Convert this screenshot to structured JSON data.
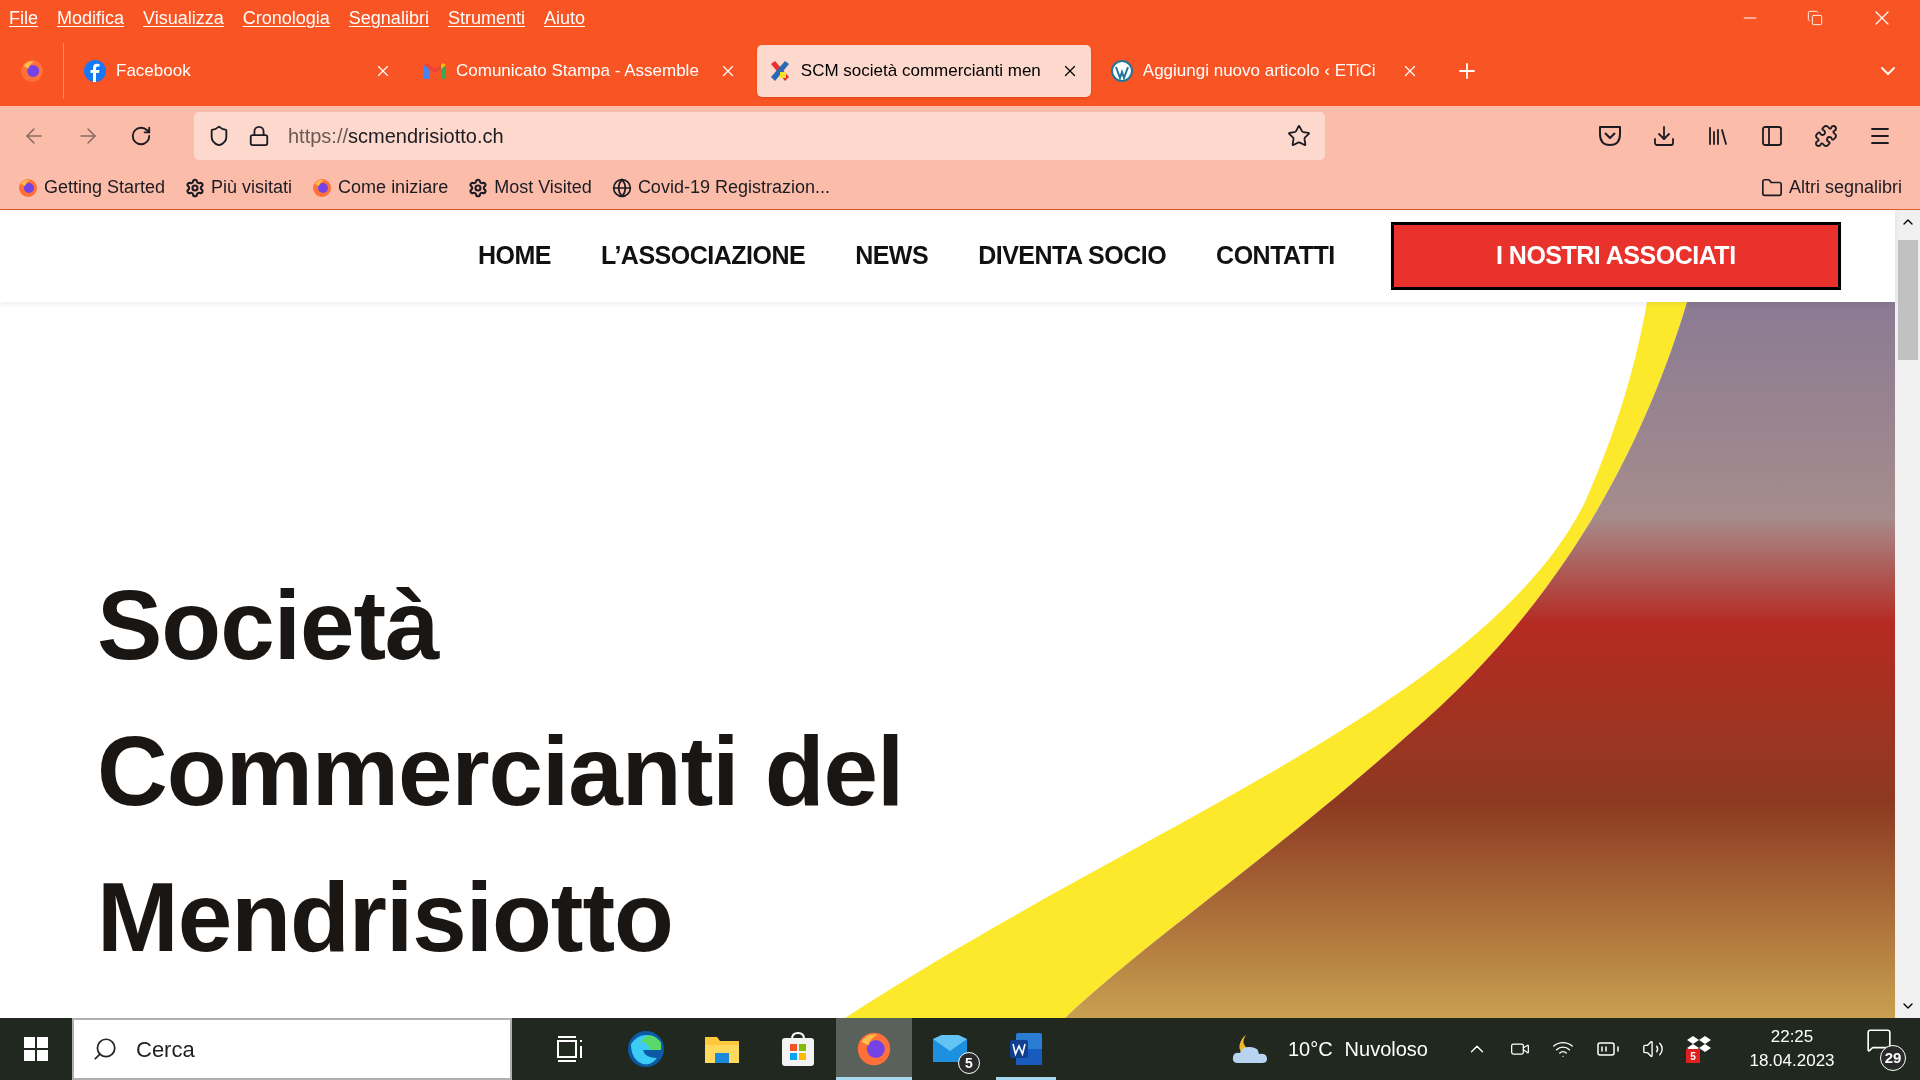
{
  "menu_bar": [
    "File",
    "Modifica",
    "Visualizza",
    "Cronologia",
    "Segnalibri",
    "Strumenti",
    "Aiuto"
  ],
  "tabs": [
    {
      "kind": "facebook",
      "label": "Facebook",
      "selected": false
    },
    {
      "kind": "gmail",
      "label": "Comunicato Stampa - Assemble",
      "selected": false
    },
    {
      "kind": "scm",
      "label": "SCM società commercianti men",
      "selected": true
    },
    {
      "kind": "wordpress",
      "label": "Aggiungi nuovo articolo ‹ ETiCi",
      "selected": false
    }
  ],
  "address_bar": {
    "scheme": "https://",
    "host": "scmendrisiotto.ch"
  },
  "bookmarks": [
    {
      "kind": "firefox",
      "label": "Getting Started"
    },
    {
      "kind": "gear",
      "label": "Più visitati"
    },
    {
      "kind": "firefox",
      "label": "Come iniziare"
    },
    {
      "kind": "gear",
      "label": "Most Visited"
    },
    {
      "kind": "globe",
      "label": "Covid-19 Registrazion..."
    }
  ],
  "other_bookmarks": "Altri segnalibri",
  "site": {
    "nav": [
      "HOME",
      "L’ASSOCIAZIONE",
      "NEWS",
      "DIVENTA SOCIO",
      "CONTATTI"
    ],
    "cta": "I NOSTRI ASSOCIATI",
    "hero_title": [
      "Società",
      "Commercianti del",
      "Mendrisiotto"
    ]
  },
  "taskbar": {
    "search_placeholder": "Cerca",
    "apps": [
      {
        "kind": "taskview",
        "active": false,
        "running": false
      },
      {
        "kind": "edge",
        "active": false,
        "running": false
      },
      {
        "kind": "explorer",
        "active": false,
        "running": false
      },
      {
        "kind": "store",
        "active": false,
        "running": false
      },
      {
        "kind": "firefox",
        "active": true,
        "running": true
      },
      {
        "kind": "mail",
        "active": false,
        "running": false,
        "badge": "5"
      },
      {
        "kind": "word",
        "active": false,
        "running": true
      }
    ],
    "weather": {
      "temperature": "10°C",
      "condition": "Nuvoloso"
    },
    "dropbox_badge": "5",
    "time": "22:25",
    "date": "18.04.2023",
    "notifications": "29"
  }
}
